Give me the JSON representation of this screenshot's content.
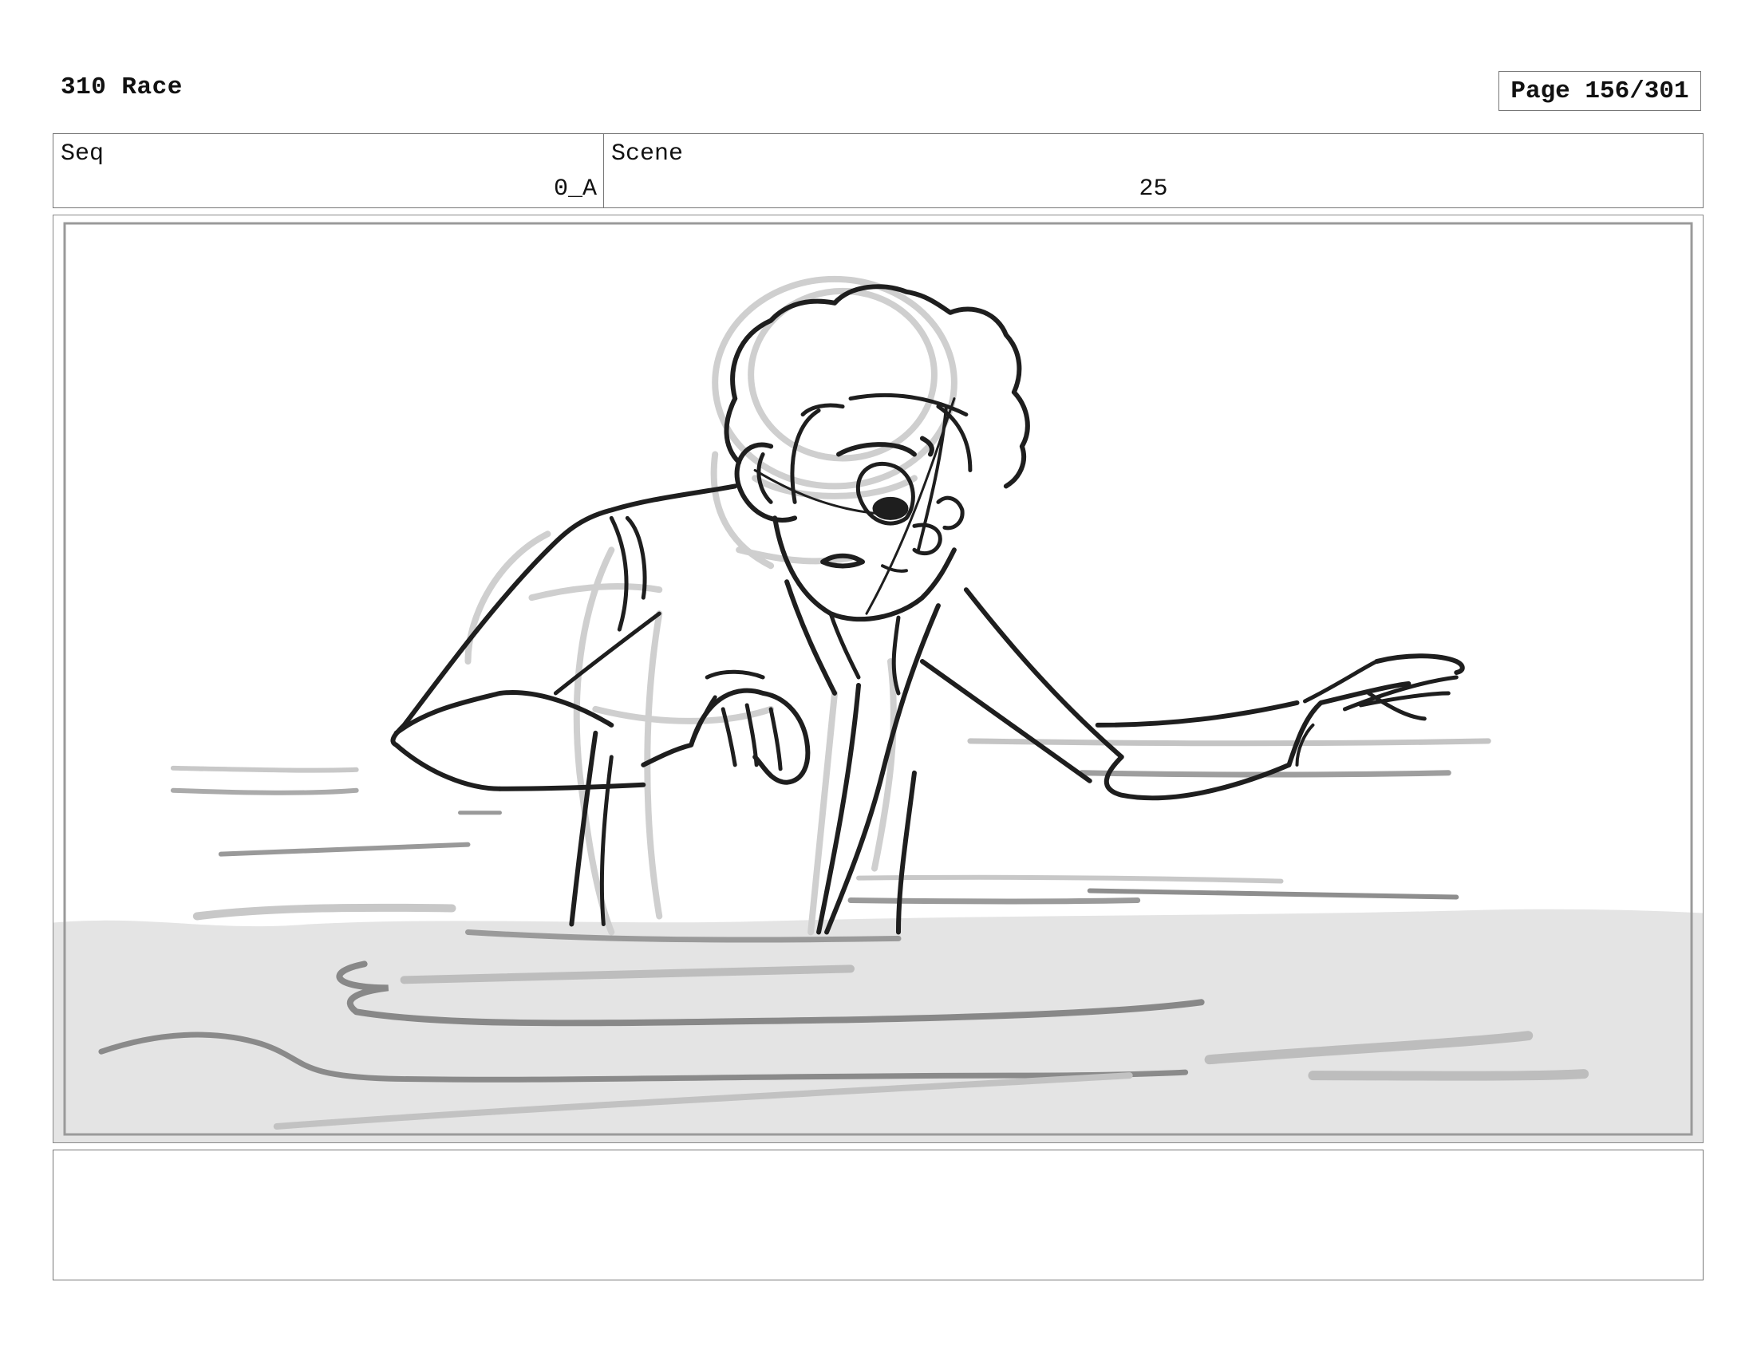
{
  "header": {
    "title": "310 Race",
    "page_label": "Page 156/301"
  },
  "info": {
    "seq_label": "Seq",
    "seq_value": "0_A",
    "scene_label": "Scene",
    "scene_value": "25"
  },
  "notes": {
    "text": ""
  }
}
